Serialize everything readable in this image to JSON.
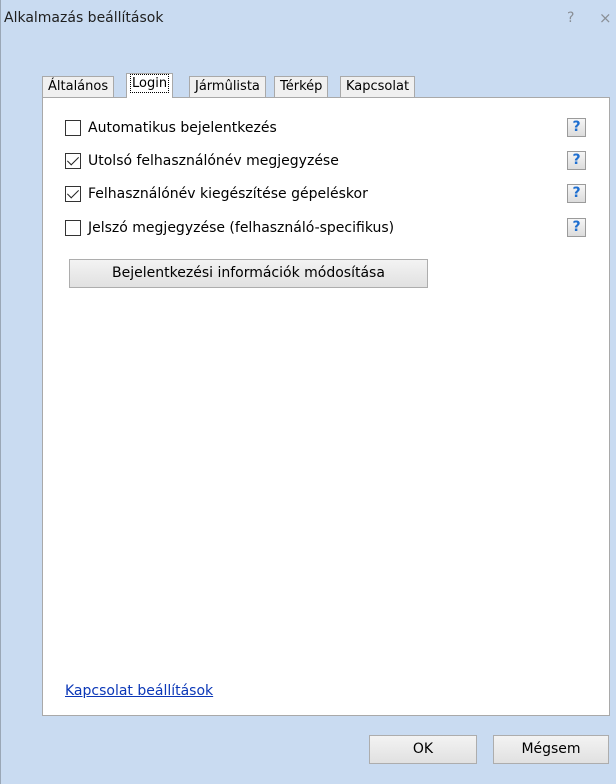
{
  "window": {
    "title": "Alkalmazás beállítások",
    "help_glyph": "?",
    "close_glyph": "×"
  },
  "tabs": [
    {
      "label": "Általános",
      "active": false
    },
    {
      "label": "Login",
      "active": true
    },
    {
      "label": "Jármûlista",
      "active": false
    },
    {
      "label": "Térkép",
      "active": false
    },
    {
      "label": "Kapcsolat",
      "active": false
    }
  ],
  "options": [
    {
      "label": "Automatikus bejelentkezés",
      "checked": false,
      "help": "?"
    },
    {
      "label": "Utolsó felhasználónév megjegyzése",
      "checked": true,
      "help": "?"
    },
    {
      "label": "Felhasználónév kiegészítése gépeléskor",
      "checked": true,
      "help": "?"
    },
    {
      "label": "Jelszó megjegyzése (felhasználó-specifikus)",
      "checked": false,
      "help": "?"
    }
  ],
  "panel": {
    "modify_button_label": "Bejelentkezési információk módosítása",
    "connection_link": "Kapcsolat beállítások"
  },
  "footer": {
    "ok_label": "OK",
    "cancel_label": "Mégsem"
  },
  "colors": {
    "window_background": "#c9dbf1",
    "link": "#0b37b7",
    "help_icon": "#1f6fd0"
  },
  "icons": {
    "title_help": "question-mark-icon",
    "title_close": "close-icon",
    "option_help": "help-question-icon",
    "checkmark": "checkmark-icon"
  }
}
